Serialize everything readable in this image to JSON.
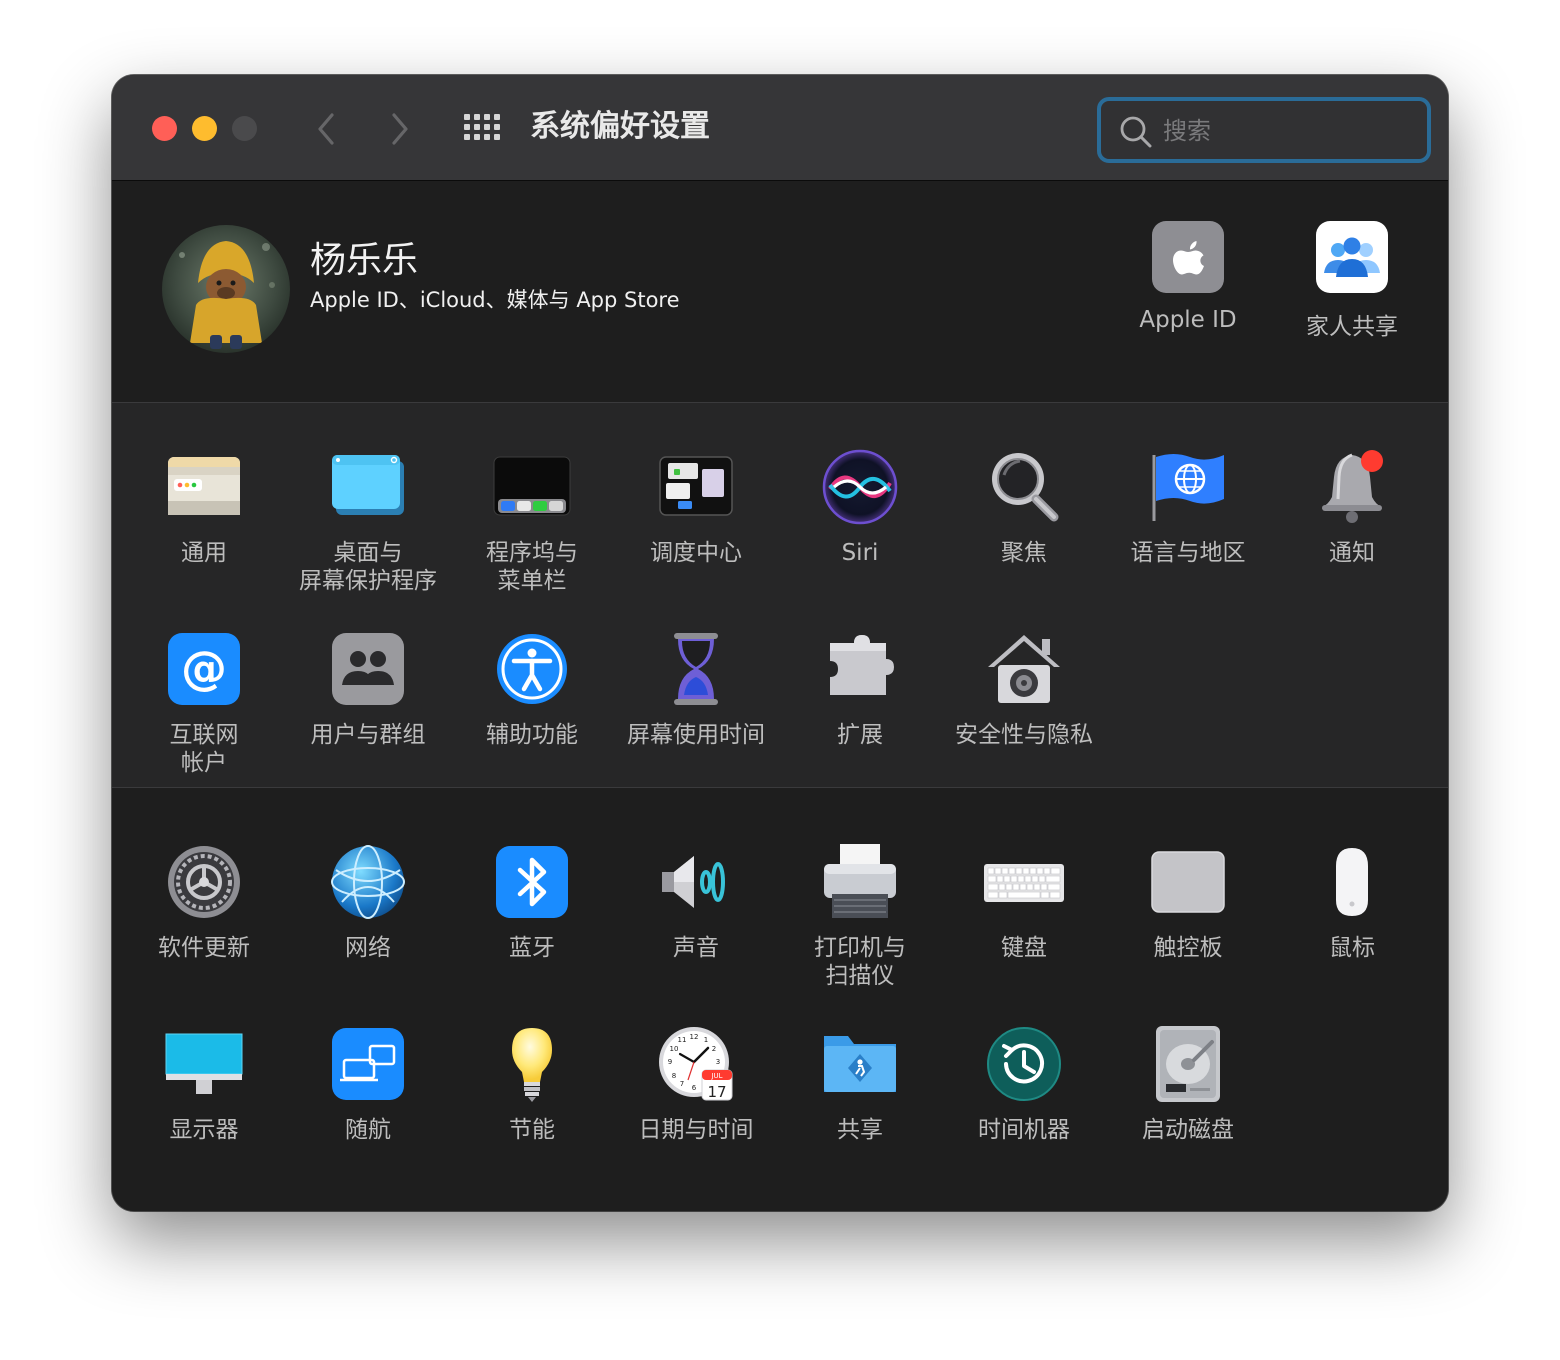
{
  "window": {
    "title": "系统偏好设置",
    "search_placeholder": "搜索"
  },
  "profile": {
    "name": "杨乐乐",
    "subtitle": "Apple ID、iCloud、媒体与 App Store",
    "shortcuts": [
      {
        "label": "Apple ID",
        "icon": "apple-logo-icon"
      },
      {
        "label": "家人共享",
        "icon": "family-sharing-icon"
      }
    ]
  },
  "section1": [
    {
      "label": "通用",
      "icon": "general-icon"
    },
    {
      "label": "桌面与\n屏幕保护程序",
      "icon": "desktop-screensaver-icon"
    },
    {
      "label": "程序坞与\n菜单栏",
      "icon": "dock-menubar-icon"
    },
    {
      "label": "调度中心",
      "icon": "mission-control-icon"
    },
    {
      "label": "Siri",
      "icon": "siri-icon"
    },
    {
      "label": "聚焦",
      "icon": "spotlight-icon"
    },
    {
      "label": "语言与地区",
      "icon": "language-region-icon"
    },
    {
      "label": "通知",
      "icon": "notifications-icon"
    },
    {
      "label": "互联网\n帐户",
      "icon": "internet-accounts-icon"
    },
    {
      "label": "用户与群组",
      "icon": "users-groups-icon"
    },
    {
      "label": "辅助功能",
      "icon": "accessibility-icon"
    },
    {
      "label": "屏幕使用时间",
      "icon": "screen-time-icon"
    },
    {
      "label": "扩展",
      "icon": "extensions-icon"
    },
    {
      "label": "安全性与隐私",
      "icon": "security-privacy-icon"
    }
  ],
  "section2": [
    {
      "label": "软件更新",
      "icon": "software-update-icon"
    },
    {
      "label": "网络",
      "icon": "network-icon"
    },
    {
      "label": "蓝牙",
      "icon": "bluetooth-icon"
    },
    {
      "label": "声音",
      "icon": "sound-icon"
    },
    {
      "label": "打印机与\n扫描仪",
      "icon": "printers-scanners-icon"
    },
    {
      "label": "键盘",
      "icon": "keyboard-icon"
    },
    {
      "label": "触控板",
      "icon": "trackpad-icon"
    },
    {
      "label": "鼠标",
      "icon": "mouse-icon"
    },
    {
      "label": "显示器",
      "icon": "displays-icon"
    },
    {
      "label": "随航",
      "icon": "sidecar-icon"
    },
    {
      "label": "节能",
      "icon": "energy-saver-icon"
    },
    {
      "label": "日期与时间",
      "icon": "date-time-icon"
    },
    {
      "label": "共享",
      "icon": "sharing-icon"
    },
    {
      "label": "时间机器",
      "icon": "time-machine-icon"
    },
    {
      "label": "启动磁盘",
      "icon": "startup-disk-icon"
    }
  ],
  "date_icon": {
    "month": "JUL",
    "day": "17"
  },
  "colors": {
    "close": "#ff5f57",
    "minimize": "#febc2e",
    "zoom_inactive": "#4a4a4c",
    "search_focus": "#2a6c98",
    "label": "#bdbdbd"
  }
}
